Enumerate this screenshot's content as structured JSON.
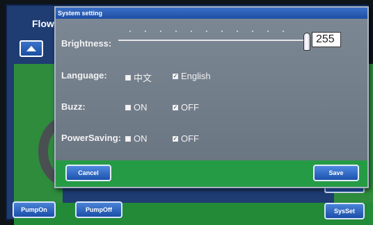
{
  "background": {
    "title": "Flow:",
    "buttons": {
      "pump_on": "PumpOn",
      "pump_off": "PumpOff",
      "sys_set": "SysSet"
    }
  },
  "dialog": {
    "title": "System setting",
    "brightness": {
      "label": "Brightness:",
      "value": "255",
      "level": 1.0
    },
    "language": {
      "label": "Language:",
      "options": [
        {
          "label": "中文",
          "checked": false
        },
        {
          "label": "English",
          "checked": true
        }
      ]
    },
    "buzz": {
      "label": "Buzz:",
      "options": [
        {
          "label": "ON",
          "checked": false
        },
        {
          "label": "OFF",
          "checked": true
        }
      ]
    },
    "power_saving": {
      "label": "PowerSaving:",
      "options": [
        {
          "label": "ON",
          "checked": false
        },
        {
          "label": "OFF",
          "checked": true
        }
      ]
    },
    "cancel_label": "Cancel",
    "save_label": "Save"
  },
  "colors": {
    "footer_green": "#269b45",
    "titlebar_blue": "#2b5fb8",
    "dialog_gray": "#7c8794"
  }
}
